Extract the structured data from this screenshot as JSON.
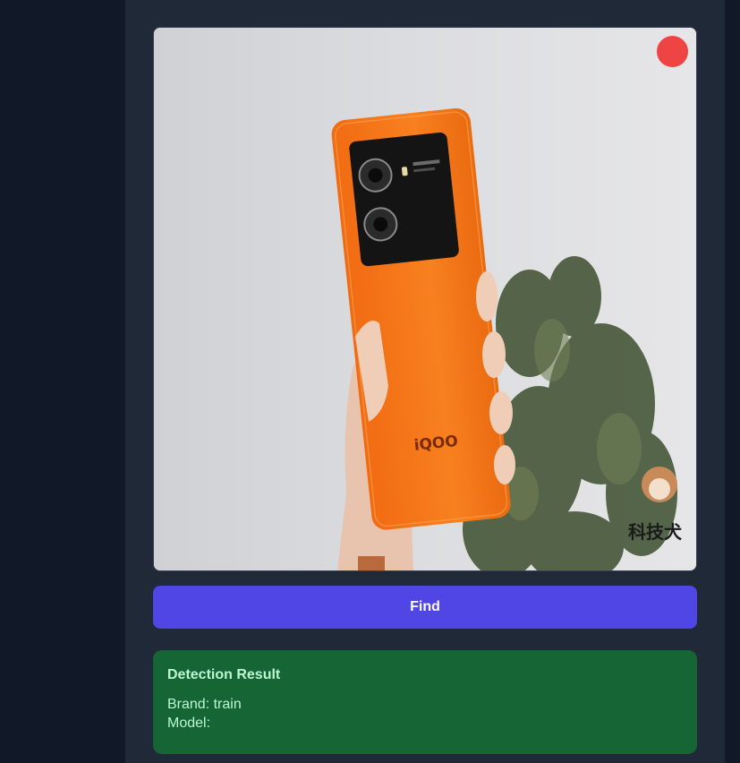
{
  "photo": {
    "phone_logo_text": "iQOO",
    "watermark_text": "科技犬"
  },
  "find_button": {
    "label": "Find"
  },
  "result": {
    "title": "Detection Result",
    "brand_label": "Brand:",
    "brand_value": "train",
    "model_label": "Model:",
    "model_value": ""
  },
  "colors": {
    "page_background": "#111827",
    "panel_background": "#1f2937",
    "button_accent": "#4f46e5",
    "result_background": "#166534",
    "result_text": "#bbf7d0",
    "remove_dot": "#ef4444",
    "phone_orange": "#f7791f"
  }
}
